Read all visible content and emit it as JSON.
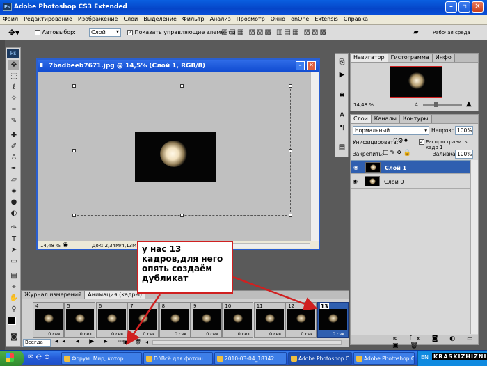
{
  "window": {
    "title": "Adobe Photoshop CS3 Extended",
    "app_icon": "Ps"
  },
  "menu": [
    "Файл",
    "Редактирование",
    "Изображение",
    "Слой",
    "Выделение",
    "Фильтр",
    "Анализ",
    "Просмотр",
    "Окно",
    "onOne",
    "Extensis",
    "Справка"
  ],
  "options": {
    "autoselect_label": "Автовыбор:",
    "autoselect_value": "Слой",
    "show_controls_label": "Показать управляющие элементы",
    "workspace_label": "Рабочая среда"
  },
  "document": {
    "title": "7badbeeb7671.jpg @ 14,5% (Слой 1, RGB/8)",
    "zoom": "14,48 %",
    "doc_info": "Док: 2,34M/4,13M"
  },
  "navigator": {
    "tabs": [
      "Навигатор",
      "Гистограмма",
      "Инфо"
    ],
    "zoom": "14,48 %"
  },
  "layers": {
    "tabs": [
      "Слои",
      "Каналы",
      "Контуры"
    ],
    "blend_mode": "Нормальный",
    "opacity_label": "Непрозр:",
    "opacity": "100%",
    "unify_label": "Унифицировать:",
    "propagate_label": "Распространить кадр 1",
    "lock_label": "Закрепить:",
    "fill_label": "Заливка:",
    "fill": "100%",
    "items": [
      {
        "name": "Слой 1",
        "selected": true
      },
      {
        "name": "Слой 0",
        "selected": false
      }
    ]
  },
  "animation": {
    "tabs": [
      "Журнал измерений",
      "Анимация (кадры)"
    ],
    "loop": "Всегда",
    "frames": [
      {
        "num": "4",
        "delay": "0 сек.",
        "selected": false
      },
      {
        "num": "5",
        "delay": "0 сек.",
        "selected": false
      },
      {
        "num": "6",
        "delay": "0 сек.",
        "selected": false
      },
      {
        "num": "7",
        "delay": "0 сек.",
        "selected": false
      },
      {
        "num": "8",
        "delay": "0 сек.",
        "selected": false
      },
      {
        "num": "9",
        "delay": "0 сек.",
        "selected": false
      },
      {
        "num": "10",
        "delay": "0 сек.",
        "selected": false
      },
      {
        "num": "11",
        "delay": "0 сек.",
        "selected": false
      },
      {
        "num": "12",
        "delay": "0 сек.",
        "selected": false
      },
      {
        "num": "13",
        "delay": "0 сек.",
        "selected": true
      }
    ]
  },
  "annotation": {
    "text": "у нас 13 кадров,для него опять создаём дубликат"
  },
  "taskbar": {
    "items": [
      "Форум: Мир, котор...",
      "D:\\Всё для фотош...",
      "2010-03-04_18342...",
      "Adobe Photoshop C...",
      "Adobe Photoshop C..."
    ],
    "lang": "EN",
    "watermark": "KRASKIZHIZNI"
  },
  "colors": {
    "accent": "#2f5fb0",
    "callout_border": "#d02020"
  }
}
